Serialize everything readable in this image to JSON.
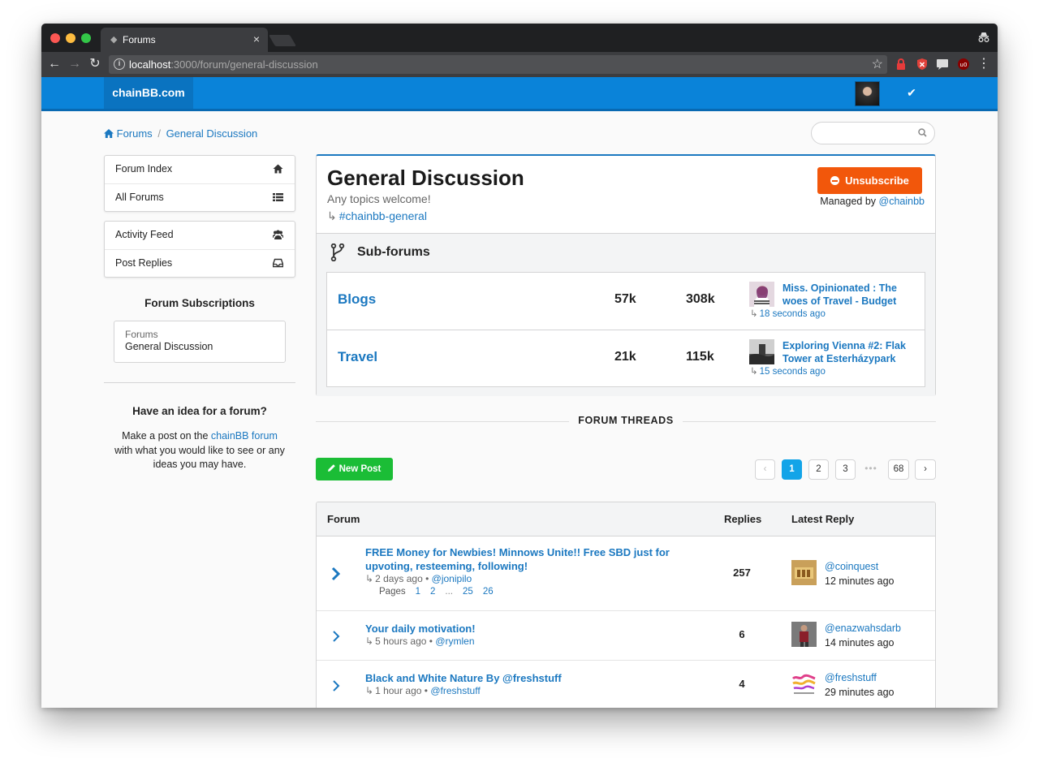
{
  "browser": {
    "tab_title": "Forums",
    "url_host": "localhost",
    "url_path": ":3000/forum/general-discussion"
  },
  "site": {
    "brand": "chainBB.com",
    "accent": "#0a83d9"
  },
  "breadcrumb": {
    "root": "Forums",
    "sep": "/",
    "current": "General Discussion"
  },
  "search": {
    "placeholder": ""
  },
  "sidebar": {
    "menu1": [
      {
        "label": "Forum Index",
        "icon": "home-icon"
      },
      {
        "label": "All Forums",
        "icon": "list-icon"
      }
    ],
    "menu2": [
      {
        "label": "Activity Feed",
        "icon": "users-icon"
      },
      {
        "label": "Post Replies",
        "icon": "inbox-icon"
      }
    ],
    "subscriptions_title": "Forum Subscriptions",
    "subscription": {
      "category": "Forums",
      "name": "General Discussion"
    },
    "idea_title": "Have an idea for a forum?",
    "idea_text_before": "Make a post on the ",
    "idea_link": "chainBB forum",
    "idea_text_after": " with what you would like to see or any ideas you may have."
  },
  "forum": {
    "title": "General Discussion",
    "description": "Any topics welcome!",
    "tag_arrow": "↳",
    "tag": "#chainbb-general",
    "unsubscribe_label": "Unsubscribe",
    "managed_by_label": "Managed by",
    "managed_by_user": "@chainbb",
    "unsubscribe_color": "#f2570b"
  },
  "subforums": {
    "title": "Sub-forums",
    "rows": [
      {
        "name": "Blogs",
        "stat1": "57k",
        "stat2": "308k",
        "latest_title": "Miss. Opinionated : The woes of Travel - Budget",
        "latest_time": "18 seconds ago"
      },
      {
        "name": "Travel",
        "stat1": "21k",
        "stat2": "115k",
        "latest_title": "Exploring Vienna #2: Flak Tower at Esterházypark",
        "latest_time": "15 seconds ago"
      }
    ]
  },
  "threads": {
    "section_label": "FORUM THREADS",
    "new_post_label": "New Post",
    "pagination": {
      "prev": "‹",
      "pages": [
        "1",
        "2",
        "3"
      ],
      "dots": "•••",
      "last": "68",
      "next": "›",
      "current": "1"
    },
    "columns": {
      "forum": "Forum",
      "replies": "Replies",
      "latest": "Latest Reply"
    },
    "rows": [
      {
        "title": "FREE Money for Newbies! Minnows Unite!! Free SBD just for upvoting, resteeming, following!",
        "age": "2 days ago",
        "author": "@jonipilo",
        "pages_label": "Pages",
        "pages": [
          "1",
          "2",
          "...",
          "25",
          "26"
        ],
        "replies": "257",
        "latest_user": "@coinquest",
        "latest_time": "12 minutes ago"
      },
      {
        "title": "Your daily motivation!",
        "age": "5 hours ago",
        "author": "@rymlen",
        "replies": "6",
        "latest_user": "@enazwahsdarb",
        "latest_time": "14 minutes ago"
      },
      {
        "title": "Black and White Nature By @freshstuff",
        "age": "1 hour ago",
        "author": "@freshstuff",
        "replies": "4",
        "latest_user": "@freshstuff",
        "latest_time": "29 minutes ago"
      }
    ]
  }
}
